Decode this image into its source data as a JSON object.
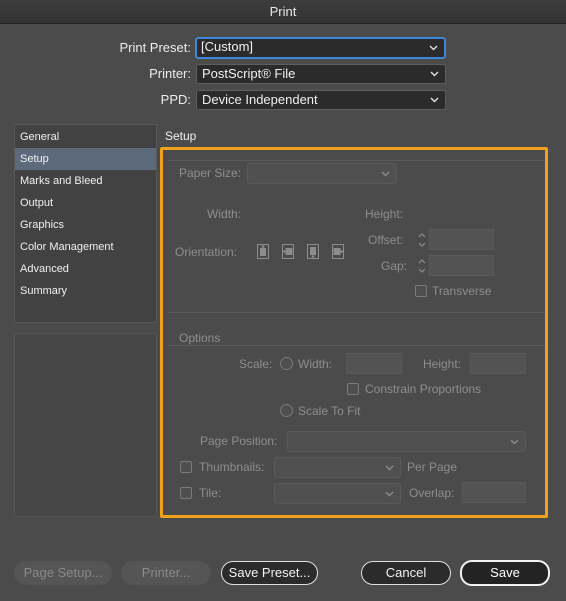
{
  "window": {
    "title": "Print"
  },
  "top_fields": {
    "print_preset": {
      "label": "Print Preset:",
      "value": "[Custom]"
    },
    "printer": {
      "label": "Printer:",
      "value": "PostScript® File"
    },
    "ppd": {
      "label": "PPD:",
      "value": "Device Independent"
    }
  },
  "sidebar": {
    "items": [
      {
        "label": "General"
      },
      {
        "label": "Setup",
        "selected": true
      },
      {
        "label": "Marks and Bleed"
      },
      {
        "label": "Output"
      },
      {
        "label": "Graphics"
      },
      {
        "label": "Color Management"
      },
      {
        "label": "Advanced"
      },
      {
        "label": "Summary"
      }
    ]
  },
  "setup": {
    "title": "Setup",
    "paper_size_label": "Paper Size:",
    "paper_size_value": "",
    "width_label": "Width:",
    "height_label": "Height:",
    "orientation_label": "Orientation:",
    "offset_label": "Offset:",
    "offset_value": "",
    "gap_label": "Gap:",
    "gap_value": "",
    "transverse_label": "Transverse",
    "transverse_checked": false
  },
  "options": {
    "title": "Options",
    "scale_label": "Scale:",
    "scale_width_label": "Width:",
    "scale_width_value": "",
    "scale_height_label": "Height:",
    "scale_height_value": "",
    "constrain_label": "Constrain Proportions",
    "scale_to_fit_label": "Scale To Fit",
    "page_position_label": "Page Position:",
    "page_position_value": "",
    "thumbnails_label": "Thumbnails:",
    "thumbnails_value": "",
    "per_page_label": "Per Page",
    "tile_label": "Tile:",
    "tile_value": "",
    "overlap_label": "Overlap:",
    "overlap_value": ""
  },
  "buttons": {
    "page_setup": "Page Setup...",
    "printer": "Printer...",
    "save_preset": "Save Preset...",
    "cancel": "Cancel",
    "save": "Save"
  },
  "colors": {
    "accent_outline": "#f0a21c",
    "selection": "#5c6a7b",
    "focus_ring": "#3d87d8",
    "background": "#4b4b4b"
  },
  "icons": {
    "dropdown": "chevron-down-icon",
    "stepper": "stepper-icon",
    "orientation": [
      "portrait-icon",
      "landscape-icon",
      "reverse-portrait-icon",
      "reverse-landscape-icon"
    ]
  }
}
